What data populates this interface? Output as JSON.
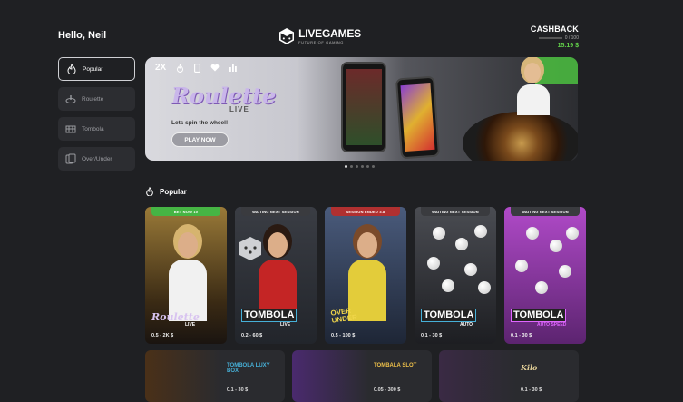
{
  "header": {
    "greeting": "Hello, Neil",
    "logo": {
      "name": "LIVEGAMES",
      "tagline": "FUTURE OF GAMING"
    },
    "cashback": {
      "title": "CASHBACK",
      "progress": "0 / 100",
      "amount": "15.19 $"
    }
  },
  "sidebar": {
    "items": [
      {
        "label": "Popular",
        "icon": "flame-icon",
        "active": true
      },
      {
        "label": "Roulette",
        "icon": "roulette-icon",
        "active": false
      },
      {
        "label": "Tombola",
        "icon": "tombola-icon",
        "active": false
      },
      {
        "label": "Over/Under",
        "icon": "cards-icon",
        "active": false
      }
    ]
  },
  "hero": {
    "multiplier": "2X",
    "title": "Roulette",
    "subtitle": "LIVE",
    "tagline": "Lets spin the wheel!",
    "cta": "PLAY NOW",
    "slides": 6,
    "active_slide": 0
  },
  "section": {
    "title": "Popular",
    "icon": "flame-icon"
  },
  "games": [
    {
      "status": "BET NOW 10",
      "status_color": "#46b544",
      "title": "Roulette",
      "subtitle": "LIVE",
      "price": "0.5 - 2K $",
      "bg": "#8a6a2c",
      "accent": "#d8c3f0"
    },
    {
      "status": "WAITING NEXT SESSION",
      "status_color": "#3a3b3f",
      "title": "TOMBOLA",
      "subtitle": "LIVE",
      "price": "0.2 - 60 $",
      "bg": "#2e3138",
      "accent": "#e53b3b"
    },
    {
      "status": "SESSION ENDED 3.8",
      "status_color": "#b03030",
      "title": "OVER UNDER",
      "subtitle": "",
      "price": "0.5 - 100 $",
      "bg": "#3a4a66",
      "accent": "#f0d64a"
    },
    {
      "status": "WAITING NEXT SESSION",
      "status_color": "#3a3b3f",
      "title": "TOMBOLA",
      "subtitle": "AUTO",
      "price": "0.1 - 30 $",
      "bg": "#35373c",
      "accent": "#46b0d8"
    },
    {
      "status": "WAITING NEXT SESSION",
      "status_color": "#3a3b3f",
      "title": "TOMBOLA",
      "subtitle": "AUTO SPEED",
      "price": "0.1 - 30 $",
      "bg": "#9b3fb0",
      "accent": "#e066ff"
    }
  ],
  "more_games": [
    {
      "title": "TOMBOLA LUXY BOX",
      "price": "0.1 - 30 $"
    },
    {
      "title": "TOMBALA SLOT",
      "price": "0.05 - 300 $"
    },
    {
      "title": "Kilo",
      "price": "0.1 - 30 $"
    }
  ]
}
